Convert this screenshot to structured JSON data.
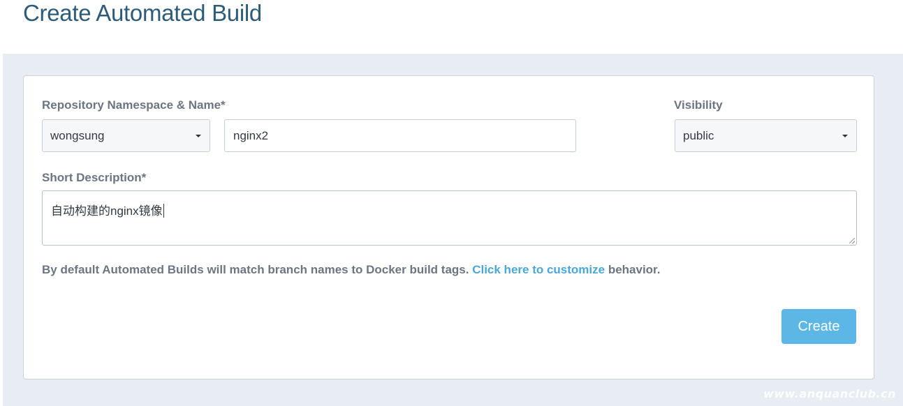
{
  "header": {
    "title": "Create Automated Build"
  },
  "form": {
    "repo_label": "Repository Namespace & Name*",
    "namespace_value": "wongsung",
    "name_value": "nginx2",
    "visibility_label": "Visibility",
    "visibility_value": "public",
    "description_label": "Short Description*",
    "description_value": "自动构建的nginx镜像",
    "help_prefix": "By default Automated Builds will match branch names to Docker build tags. ",
    "help_link": "Click here to customize",
    "help_suffix": " behavior.",
    "create_label": "Create"
  },
  "watermark": "www.anquanclub.cn",
  "colors": {
    "title": "#2d5b7a",
    "link": "#4aa7d9",
    "button": "#5cb6e6",
    "background": "#e8ecf3"
  }
}
